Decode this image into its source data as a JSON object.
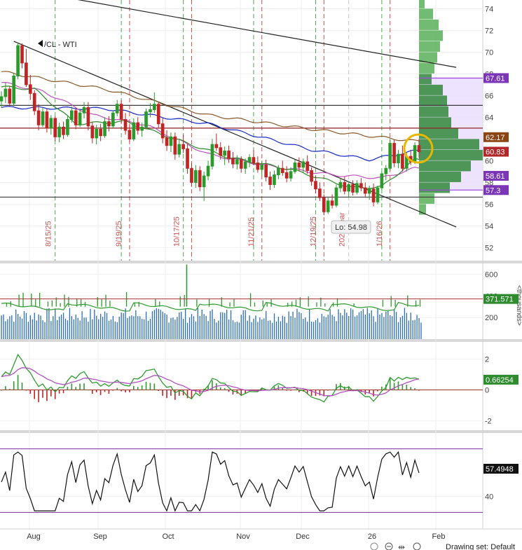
{
  "symbol_label": "/CL - WTI",
  "status": {
    "drawing_set": "Drawing set: Default"
  },
  "chart_data": [
    {
      "panel": "price",
      "type": "candlestick",
      "ylim": [
        50.8,
        74.8
      ],
      "ticks": [
        52,
        54,
        56,
        58,
        60,
        62,
        64,
        66,
        68,
        70,
        72,
        74
      ],
      "candles": [
        [
          65.5,
          66.4,
          64.9,
          65.9
        ],
        [
          65.9,
          67.2,
          65.3,
          66.6
        ],
        [
          66.6,
          66.9,
          65.0,
          65.3
        ],
        [
          65.3,
          68.1,
          65.0,
          67.8
        ],
        [
          67.8,
          70.9,
          67.5,
          70.6
        ],
        [
          70.6,
          70.8,
          68.5,
          69.0
        ],
        [
          69.0,
          70.3,
          66.8,
          67.0
        ],
        [
          67.0,
          67.9,
          65.6,
          66.2
        ],
        [
          66.2,
          66.5,
          64.2,
          64.6
        ],
        [
          64.6,
          65.2,
          62.8,
          63.3
        ],
        [
          63.3,
          64.9,
          63.1,
          64.5
        ],
        [
          64.5,
          64.8,
          62.6,
          63.0
        ],
        [
          63.0,
          64.2,
          62.4,
          63.9
        ],
        [
          63.9,
          64.1,
          61.8,
          62.2
        ],
        [
          62.2,
          63.5,
          61.7,
          63.1
        ],
        [
          63.1,
          63.6,
          62.0,
          62.4
        ],
        [
          62.4,
          64.1,
          62.2,
          63.8
        ],
        [
          63.8,
          65.0,
          63.5,
          64.6
        ],
        [
          64.6,
          64.9,
          62.9,
          63.3
        ],
        [
          63.3,
          64.8,
          63.1,
          64.4
        ],
        [
          64.4,
          65.4,
          63.9,
          64.9
        ],
        [
          64.9,
          65.4,
          62.8,
          63.2
        ],
        [
          63.2,
          63.6,
          61.6,
          62.1
        ],
        [
          62.1,
          63.3,
          61.5,
          62.9
        ],
        [
          62.9,
          63.4,
          61.8,
          62.3
        ],
        [
          62.3,
          64.0,
          62.1,
          63.6
        ],
        [
          63.6,
          64.1,
          62.7,
          63.2
        ],
        [
          63.2,
          64.6,
          63.0,
          64.4
        ],
        [
          64.4,
          65.6,
          64.1,
          65.2
        ],
        [
          65.2,
          65.6,
          63.4,
          63.8
        ],
        [
          63.8,
          64.4,
          62.4,
          62.8
        ],
        [
          62.8,
          63.4,
          61.7,
          62.0
        ],
        [
          62.0,
          63.9,
          61.8,
          63.5
        ],
        [
          63.5,
          64.0,
          62.4,
          62.8
        ],
        [
          62.8,
          63.5,
          62.2,
          63.1
        ],
        [
          63.1,
          64.8,
          62.9,
          64.5
        ],
        [
          64.5,
          65.3,
          64.0,
          64.7
        ],
        [
          64.7,
          66.3,
          64.4,
          65.2
        ],
        [
          65.2,
          65.4,
          63.0,
          63.4
        ],
        [
          63.4,
          63.9,
          61.6,
          62.1
        ],
        [
          62.1,
          62.8,
          60.9,
          61.4
        ],
        [
          61.4,
          62.6,
          60.8,
          62.2
        ],
        [
          62.2,
          62.6,
          60.1,
          60.6
        ],
        [
          60.6,
          61.9,
          60.3,
          61.5
        ],
        [
          61.5,
          62.4,
          60.7,
          61.1
        ],
        [
          61.1,
          61.5,
          58.8,
          59.3
        ],
        [
          59.3,
          59.8,
          57.6,
          58.0
        ],
        [
          58.0,
          59.6,
          57.5,
          59.1
        ],
        [
          59.1,
          59.5,
          57.2,
          57.6
        ],
        [
          57.6,
          59.0,
          56.3,
          58.6
        ],
        [
          58.6,
          60.0,
          58.2,
          59.5
        ],
        [
          59.5,
          62.0,
          59.2,
          61.5
        ],
        [
          61.5,
          62.5,
          60.9,
          61.2
        ],
        [
          61.2,
          61.7,
          60.1,
          60.5
        ],
        [
          60.5,
          61.3,
          59.6,
          60.9
        ],
        [
          60.9,
          61.4,
          59.8,
          60.2
        ],
        [
          60.2,
          60.8,
          59.3,
          59.7
        ],
        [
          59.7,
          60.5,
          59.2,
          60.1
        ],
        [
          60.1,
          60.4,
          58.9,
          59.3
        ],
        [
          59.3,
          60.2,
          58.8,
          59.9
        ],
        [
          59.9,
          60.6,
          59.4,
          60.3
        ],
        [
          60.3,
          61.0,
          59.6,
          59.8
        ],
        [
          59.8,
          60.4,
          58.9,
          59.2
        ],
        [
          59.2,
          60.0,
          58.6,
          59.6
        ],
        [
          59.6,
          60.1,
          58.1,
          58.5
        ],
        [
          58.5,
          59.0,
          57.3,
          57.8
        ],
        [
          57.8,
          59.1,
          57.5,
          58.7
        ],
        [
          58.7,
          59.6,
          58.3,
          59.3
        ],
        [
          59.3,
          60.0,
          58.6,
          58.9
        ],
        [
          58.9,
          59.5,
          58.0,
          58.4
        ],
        [
          58.4,
          59.4,
          58.1,
          59.0
        ],
        [
          59.0,
          60.1,
          58.8,
          59.8
        ],
        [
          59.8,
          60.3,
          59.0,
          59.4
        ],
        [
          59.4,
          60.2,
          58.9,
          59.9
        ],
        [
          59.9,
          60.5,
          58.8,
          59.1
        ],
        [
          59.1,
          59.4,
          57.7,
          58.1
        ],
        [
          58.1,
          58.6,
          57.0,
          57.4
        ],
        [
          57.4,
          58.0,
          56.3,
          56.6
        ],
        [
          56.6,
          56.9,
          54.98,
          55.3
        ],
        [
          55.3,
          56.6,
          55.1,
          56.3
        ],
        [
          56.3,
          56.9,
          55.6,
          55.9
        ],
        [
          55.9,
          57.8,
          55.7,
          57.5
        ],
        [
          57.5,
          58.4,
          57.1,
          58.0
        ],
        [
          58.0,
          58.5,
          56.9,
          57.2
        ],
        [
          57.2,
          58.1,
          56.6,
          57.8
        ],
        [
          57.8,
          58.2,
          56.8,
          57.1
        ],
        [
          57.1,
          58.2,
          56.9,
          57.9
        ],
        [
          57.9,
          58.4,
          57.2,
          57.5
        ],
        [
          57.5,
          58.0,
          56.7,
          57.0
        ],
        [
          57.0,
          57.7,
          56.4,
          57.4
        ],
        [
          57.4,
          57.9,
          55.8,
          56.2
        ],
        [
          56.2,
          57.7,
          56.0,
          57.5
        ],
        [
          57.5,
          59.0,
          57.3,
          58.8
        ],
        [
          58.8,
          59.6,
          58.2,
          59.3
        ],
        [
          59.3,
          62.0,
          59.1,
          61.6
        ],
        [
          61.6,
          61.9,
          59.4,
          59.8
        ],
        [
          59.8,
          61.0,
          59.3,
          60.6
        ],
        [
          60.6,
          61.4,
          59.0,
          59.3
        ],
        [
          59.3,
          60.7,
          59.0,
          60.4
        ],
        [
          60.4,
          61.0,
          59.6,
          59.9
        ],
        [
          59.9,
          61.7,
          59.7,
          61.4
        ],
        [
          61.4,
          62.0,
          60.3,
          60.83
        ]
      ],
      "moving_averages": [
        {
          "color": "#8B5A2B",
          "values": [
            [
              0,
              68.2
            ],
            [
              25,
              66.6
            ],
            [
              50,
              64.2
            ],
            [
              75,
              62.9
            ],
            [
              100,
              61.8
            ]
          ]
        },
        {
          "color": "#1428C8",
          "values": [
            [
              0,
              64.9
            ],
            [
              25,
              64.8
            ],
            [
              50,
              63.4
            ],
            [
              75,
              61.0
            ],
            [
              89,
              60.1
            ],
            [
              100,
              60.9
            ]
          ]
        },
        {
          "color": "#C050C0",
          "values": [
            [
              0,
              67.2
            ],
            [
              10,
              66.4
            ],
            [
              22,
              64.2
            ],
            [
              35,
              63.3
            ],
            [
              50,
              60.6
            ],
            [
              65,
              59.5
            ],
            [
              80,
              58.7
            ],
            [
              92,
              58.4
            ],
            [
              100,
              59.3
            ]
          ]
        },
        {
          "color": "#2E8B2E",
          "values": [
            [
              0,
              66.8
            ],
            [
              8,
              66.6
            ],
            [
              18,
              63.4
            ],
            [
              30,
              63.6
            ],
            [
              45,
              61.6
            ],
            [
              55,
              60.3
            ],
            [
              70,
              59.2
            ],
            [
              85,
              57.5
            ],
            [
              92,
              57.6
            ],
            [
              100,
              60.1
            ]
          ]
        }
      ],
      "reference_lines": [
        {
          "value": 65.1,
          "color": "#3A3A3A"
        },
        {
          "value": 56.65,
          "color": "#3A3A3A"
        },
        {
          "value": 63.0,
          "color": "#8B2020"
        }
      ],
      "annotations": {
        "low_label": "Lo: 54.98",
        "event_markers": [
          "8/15/25",
          "9/19/25",
          "10/17/25",
          "11/21/25",
          "12/19/25",
          "2025 year",
          "1/16/26"
        ]
      },
      "price_tags": [
        {
          "value": 67.61,
          "text": "67.61",
          "bg": "#7B36B7"
        },
        {
          "value": 62.17,
          "text": "62.17",
          "bg": "#8B4513"
        },
        {
          "value": 60.83,
          "text": "60.83",
          "bg": "#B02828"
        },
        {
          "value": 58.61,
          "text": "58.61",
          "bg": "#7B36B7"
        },
        {
          "value": 57.3,
          "text": "57.3",
          "bg": "#7B36B7"
        }
      ],
      "volume_profile": [
        [
          74.5,
          8
        ],
        [
          73.5,
          20
        ],
        [
          72.5,
          28
        ],
        [
          71.5,
          34
        ],
        [
          70.5,
          30
        ],
        [
          69.5,
          26
        ],
        [
          68.5,
          22
        ],
        [
          67.5,
          18
        ],
        [
          66.5,
          34
        ],
        [
          65.5,
          40
        ],
        [
          64.5,
          42
        ],
        [
          63.5,
          46
        ],
        [
          62.5,
          56
        ],
        [
          61.5,
          86
        ],
        [
          60.5,
          92
        ],
        [
          59.5,
          74
        ],
        [
          58.5,
          60
        ],
        [
          57.5,
          44
        ],
        [
          56.5,
          22
        ],
        [
          55.5,
          10
        ]
      ]
    },
    {
      "panel": "volume",
      "type": "bar",
      "unit_label": "<thousands>",
      "ylim": [
        0,
        700
      ],
      "ticks": [
        200,
        400,
        600
      ],
      "last_value": "371.571",
      "average_line": 371.571
    },
    {
      "panel": "macd",
      "type": "histogram+line",
      "ylim": [
        -2.6,
        3.1
      ],
      "ticks": [
        -2,
        0,
        2
      ],
      "last_value": "0.66254"
    },
    {
      "panel": "oscillator",
      "type": "line",
      "ylim": [
        20,
        80
      ],
      "ticks": [
        40
      ],
      "upper_band": 70,
      "lower_band": 30,
      "last_value": "57.4948"
    },
    {
      "panel": "x-axis",
      "type": "dates",
      "month_labels": [
        "Aug",
        "Sep",
        "Oct",
        "Nov",
        "Dec",
        "26",
        "Feb"
      ]
    }
  ]
}
